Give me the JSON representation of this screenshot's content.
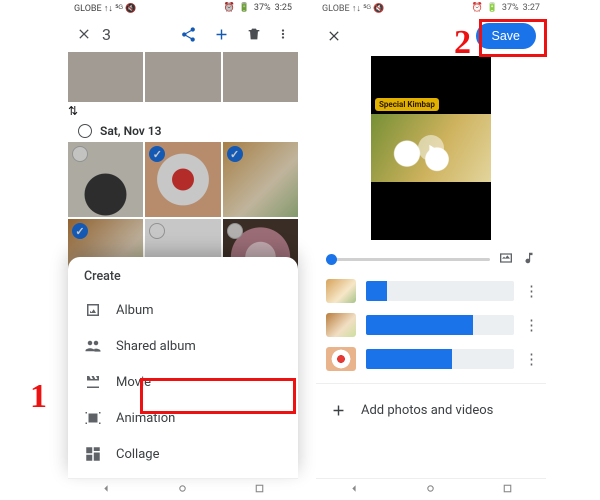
{
  "callouts": {
    "one": "1",
    "two": "2"
  },
  "left": {
    "status": {
      "carrier": "GLOBE ↑↓ ⁵ᴳ 🔇",
      "battery": "37%",
      "time": "3:25",
      "alarm": "⏰"
    },
    "appbar": {
      "selected_count": "3"
    },
    "date_header": "Sat, Nov 13",
    "sheet": {
      "title": "Create",
      "items": {
        "album": "Album",
        "shared_album": "Shared album",
        "movie": "Movie",
        "animation": "Animation",
        "collage": "Collage"
      }
    }
  },
  "right": {
    "status": {
      "carrier": "GLOBE ↑↓ ⁵ᴳ 🔇",
      "battery": "37%",
      "time": "3:27",
      "alarm": "⏰"
    },
    "save_label": "Save",
    "preview": {
      "badge": "Special Kimbap"
    },
    "clips": [
      {
        "id": "clip1",
        "fill_pct": 14
      },
      {
        "id": "clip2",
        "fill_pct": 72
      },
      {
        "id": "clip3",
        "fill_pct": 58
      }
    ],
    "add_label": "Add photos and videos"
  }
}
